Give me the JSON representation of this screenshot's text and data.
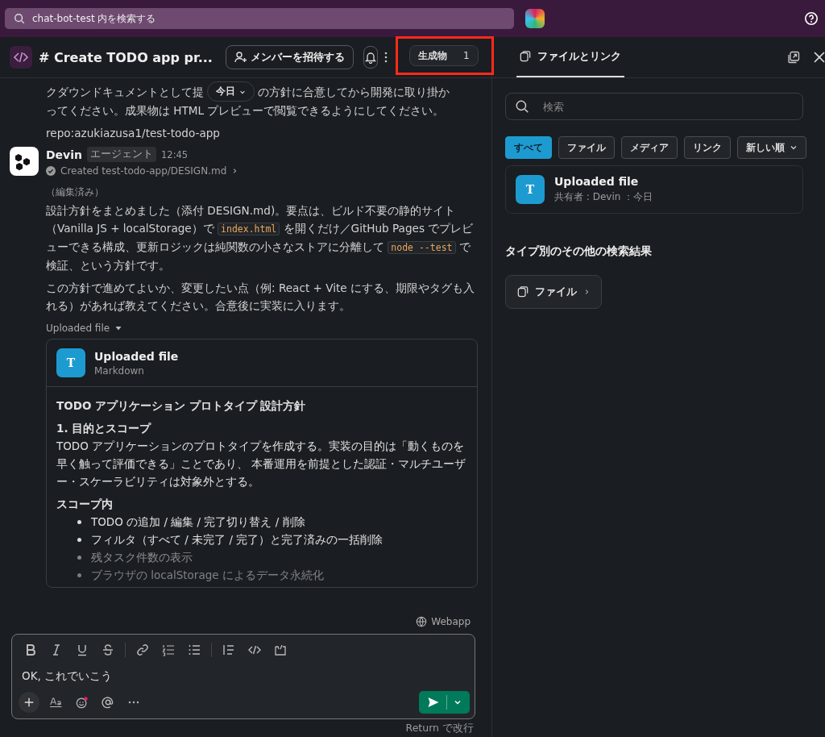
{
  "top_bar": {
    "search": {
      "placeholder": "chat-bot-test 内を検索する"
    }
  },
  "channel": {
    "title": "# Create TODO app pr...",
    "invite_button": "メンバーを招待する",
    "artifacts": {
      "label": "生成物",
      "count": "1"
    }
  },
  "messages": [
    {
      "kind": "continuation",
      "text_before": "クダウンドキュメントとして提",
      "date_pill": "今日",
      "text_after": "の方針に合意してから開発に取り掛か",
      "text_next_line": "ってください。成果物は HTML プレビューで閲覧できるようにしてください。",
      "repo": "repo:azukiazusa1/test-todo-app"
    },
    {
      "kind": "bot",
      "author": "Devin",
      "badge": "エージェント",
      "time": "12:45",
      "action": "Created test-todo-app/DESIGN.md",
      "edited": "（編集済み）",
      "paragraphs": [
        [
          {
            "kind": "text",
            "text": "設計方針をまとめました（添付 DESIGN.md)。要点は、ビルド不要の静的サイト（Vanilla JS + localStorage）で "
          },
          {
            "kind": "code",
            "text": "index.html"
          },
          {
            "kind": "text",
            "text": " を開くだけ／GitHub Pages でプレビューできる構成、更新ロジックは純関数の小さなストアに分離して "
          },
          {
            "kind": "code",
            "text": "node --test"
          },
          {
            "kind": "text",
            "text": " で検証、という方針です。"
          }
        ],
        [
          {
            "kind": "text",
            "text": "この方針で進めてよいか、変更したい点（例: React + Vite にする、期限やタグも入れる）があれば教えてください。合意後に実装に入ります。"
          }
        ]
      ],
      "attachment_toggle": "Uploaded file",
      "file": {
        "icon_letter": "T",
        "name": "Uploaded file",
        "type": "Markdown",
        "preview": [
          {
            "kind": "title",
            "text": "TODO アプリケーション プロトタイプ 設計方針"
          },
          {
            "kind": "heading",
            "text": "1. 目的とスコープ"
          },
          {
            "kind": "para",
            "text": "TODO アプリケーションのプロトタイプを作成する。実装の目的は「動くものを早く触って評価できる」ことであり、 本番運用を前提とした認証・マルチユーザー・スケーラビリティは対象外とする。"
          },
          {
            "kind": "heading",
            "text": "スコープ内"
          },
          {
            "kind": "bullet",
            "text": "TODO の追加 / 編集 / 完了切り替え / 削除"
          },
          {
            "kind": "bullet",
            "text": "フィルタ（すべて / 未完了 / 完了）と完了済みの一括削除"
          },
          {
            "kind": "bullet",
            "text": "残タスク件数の表示"
          },
          {
            "kind": "bullet",
            "text": "ブラウザの localStorage によるデータ永続化"
          }
        ]
      }
    }
  ],
  "app_tag": "Webapp",
  "composer": {
    "value": "OK, これでいこう",
    "hint": "Return で改行"
  },
  "side_panel": {
    "tab": {
      "label": "ファイルとリンク",
      "selected": true
    },
    "search": {
      "placeholder": "検索"
    },
    "filters": [
      {
        "label": "すべて",
        "selected": true
      },
      {
        "label": "ファイル",
        "selected": false
      },
      {
        "label": "メディア",
        "selected": false
      },
      {
        "label": "リンク",
        "selected": false
      }
    ],
    "sort": "新しい順",
    "files": [
      {
        "icon_letter": "T",
        "name": "Uploaded file",
        "meta": "共有者 : Devin ：今日"
      }
    ],
    "more_heading": "タイプ別のその他の検索結果",
    "more_buttons": [
      "ファイル"
    ]
  }
}
